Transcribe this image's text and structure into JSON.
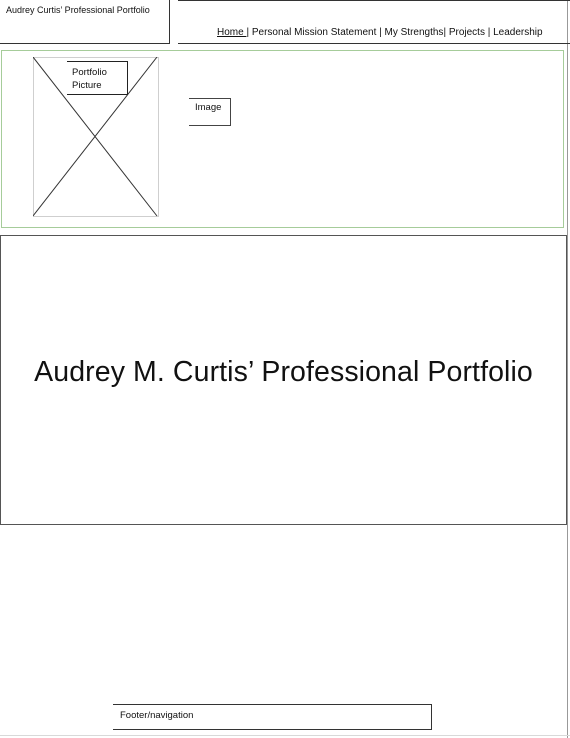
{
  "site_title": "Audrey Curtis’ Professional Portfolio",
  "nav": {
    "items": [
      "Home ",
      "Personal Mission Statement",
      "My Strengths",
      "Projects",
      "Leadership"
    ],
    "sep": " | ",
    "sep_tight": "| "
  },
  "header": {
    "portfolio_picture_label_line1": "Portfolio",
    "portfolio_picture_label_line2": "Picture",
    "image_label": "Image"
  },
  "hero": {
    "title": "Audrey M. Curtis’ Professional Portfolio"
  },
  "footer": {
    "label": "Footer/navigation"
  },
  "colors": {
    "header_border": "#a6cc9a",
    "line": "#333333"
  }
}
